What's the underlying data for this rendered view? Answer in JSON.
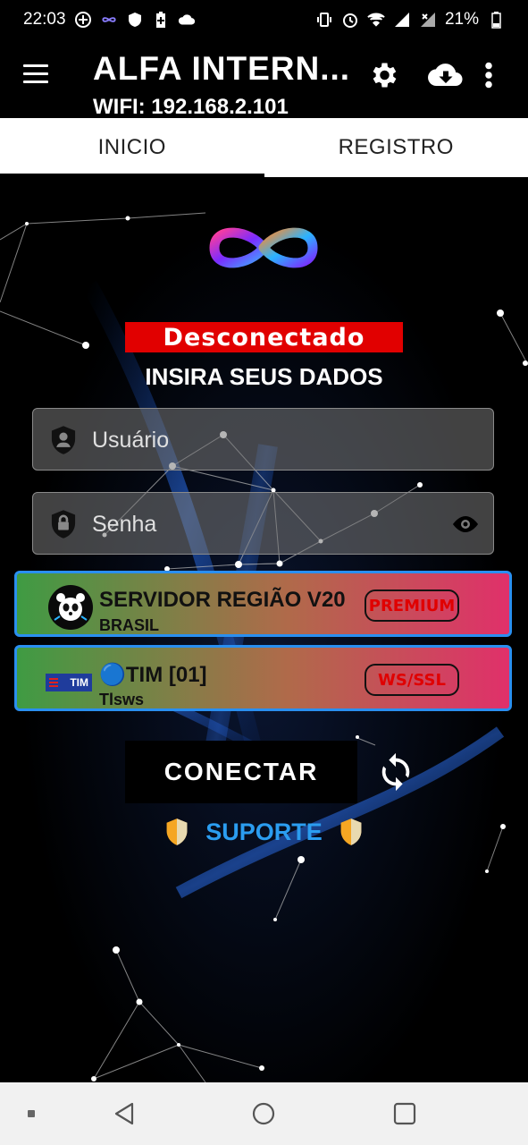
{
  "status_bar": {
    "time": "22:03",
    "battery": "21%",
    "left_icons": [
      "plus-circle-icon",
      "infinity-icon",
      "shield-icon",
      "battery-plus-icon",
      "cloud-icon"
    ],
    "right_icons": [
      "vibrate-icon",
      "alarm-icon",
      "wifi-icon",
      "signal-icon",
      "signal-x-icon",
      "battery-icon"
    ]
  },
  "app_bar": {
    "title": "ALFA INTERN...",
    "subtitle": "WIFI: 192.168.2.101",
    "icons": [
      "menu-icon",
      "gear-icon",
      "cloud-download-icon",
      "more-vert-icon"
    ]
  },
  "tabs": [
    {
      "label": "INICIO",
      "active": true
    },
    {
      "label": "REGISTRO",
      "active": false
    }
  ],
  "main": {
    "status": "Desconectado",
    "status_color": "#e10000",
    "prompt": "INSIRA SEUS DADOS",
    "username": {
      "placeholder": "Usuário",
      "value": ""
    },
    "password": {
      "placeholder": "Senha",
      "value": ""
    },
    "server": {
      "name": "SERVIDOR REGIÃO V20",
      "subtitle": "BRASIL",
      "tag": "PREMIUM"
    },
    "network": {
      "name": "🔵TIM [01]",
      "subtitle": "Tlsws",
      "tag": "WS/SSL",
      "logo_text": "TIM"
    },
    "connect_label": "CONECTAR",
    "support_label": "SUPORTE",
    "accent_color": "#2b9df0"
  },
  "nav_bar": {
    "buttons": [
      "recent-dot-icon",
      "back-icon",
      "home-icon",
      "overview-icon"
    ]
  }
}
